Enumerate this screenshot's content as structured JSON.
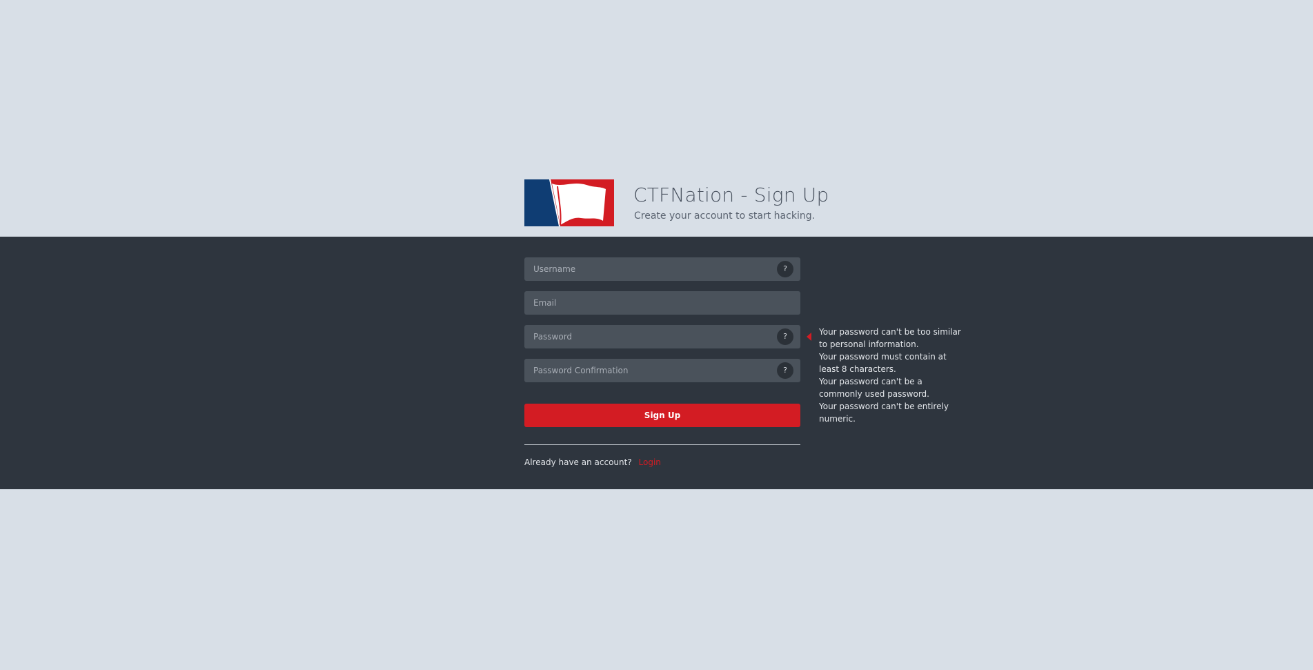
{
  "header": {
    "title": "CTFNation - Sign Up",
    "subtitle": "Create your account to start hacking."
  },
  "colors": {
    "page_background": "#d8dfe7",
    "band_background": "#2e353e",
    "accent_red": "#d31c23",
    "logo_blue": "#0f3d73"
  },
  "form": {
    "username_placeholder": "Username",
    "email_placeholder": "Email",
    "password_placeholder": "Password",
    "password_confirmation_placeholder": "Password Confirmation",
    "help_glyph": "?",
    "submit_label": "Sign Up"
  },
  "login": {
    "prompt": "Already have an account?",
    "link_label": "Login"
  },
  "password_help": {
    "lines": [
      "Your password can't be too similar to personal information.",
      "Your password must contain at least 8 characters.",
      "Your password can't be a commonly used password.",
      "Your password can't be entirely numeric."
    ]
  },
  "icons": {
    "logo": "flag-logo-icon",
    "help": "question-mark-icon",
    "tooltip_pointer": "caret-left-icon"
  }
}
